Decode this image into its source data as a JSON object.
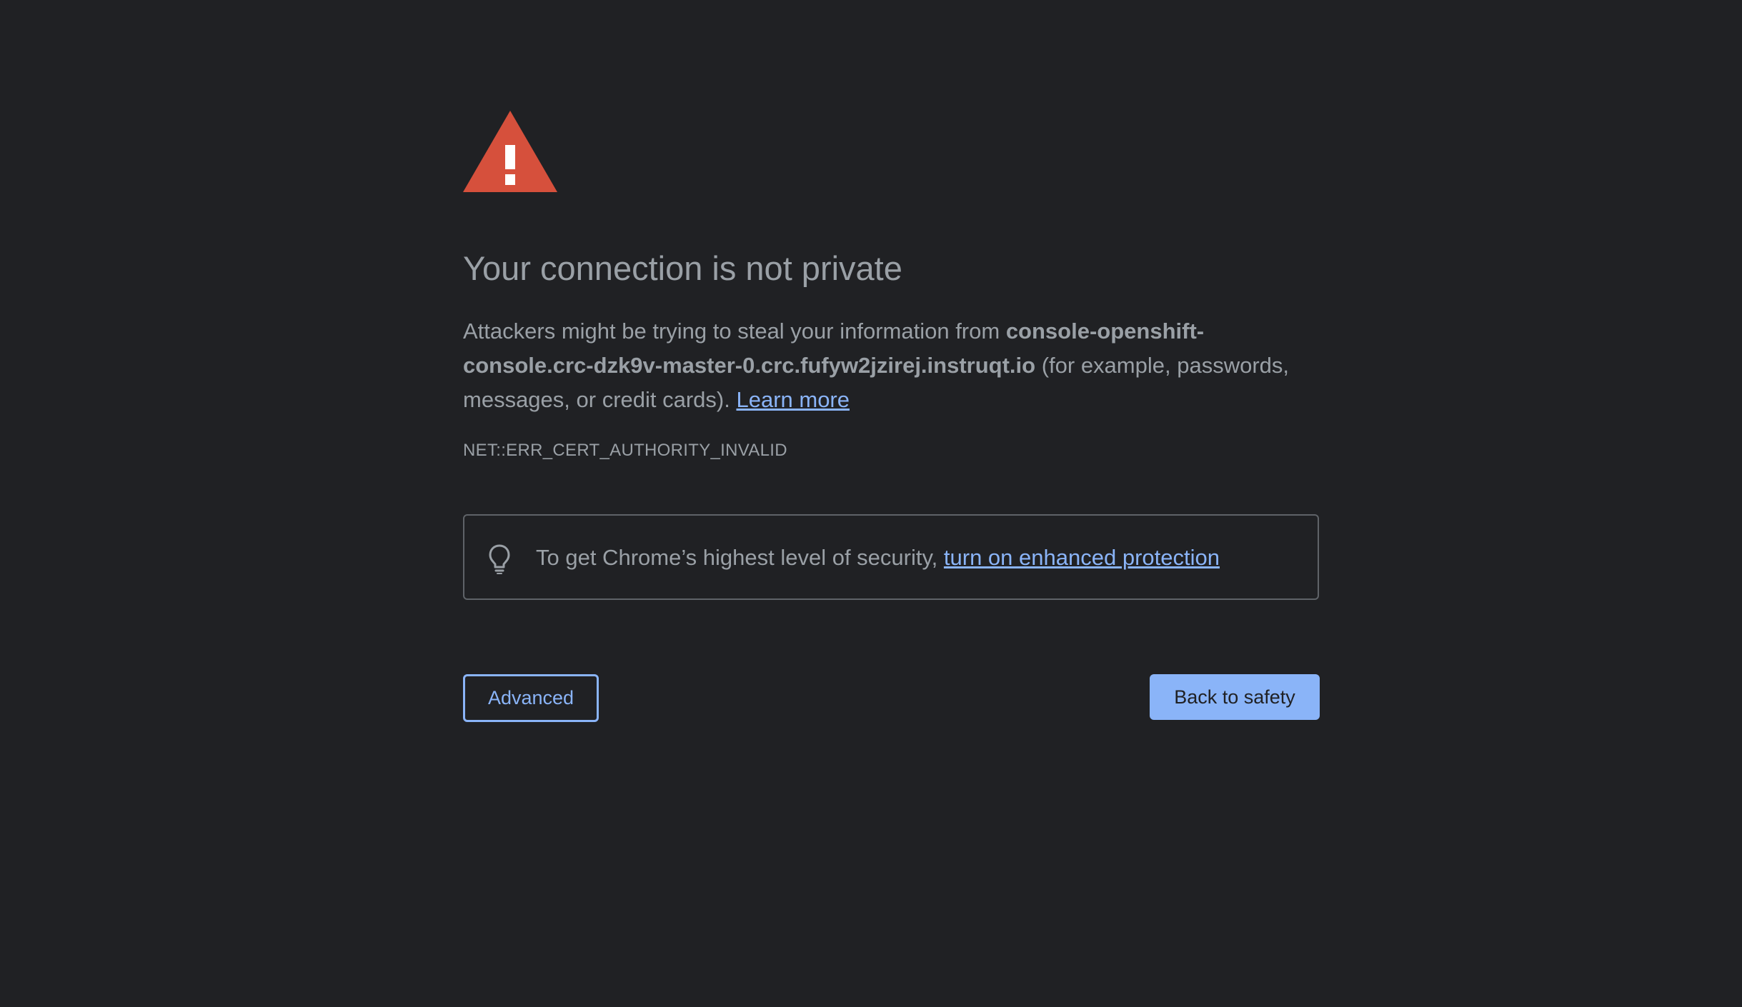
{
  "page": {
    "background_color": "#202124",
    "accent_color": "#8ab4f8",
    "warning_color": "#d6503c"
  },
  "header": {
    "icon": "warning-triangle-icon",
    "title": "Your connection is not private"
  },
  "message": {
    "prefix": "Attackers might be trying to steal your information from ",
    "hostname": "console-openshift-console.crc-dzk9v-master-0.crc.fufyw2jzirej.instruqt.io",
    "suffix": " (for example, passwords, messages, or credit cards). ",
    "learn_more_label": "Learn more"
  },
  "error_code": "NET::ERR_CERT_AUTHORITY_INVALID",
  "enhanced_protection": {
    "icon": "lightbulb-icon",
    "text": "To get Chrome’s highest level of security, ",
    "link_label": "turn on enhanced protection"
  },
  "buttons": {
    "advanced_label": "Advanced",
    "back_label": "Back to safety"
  }
}
